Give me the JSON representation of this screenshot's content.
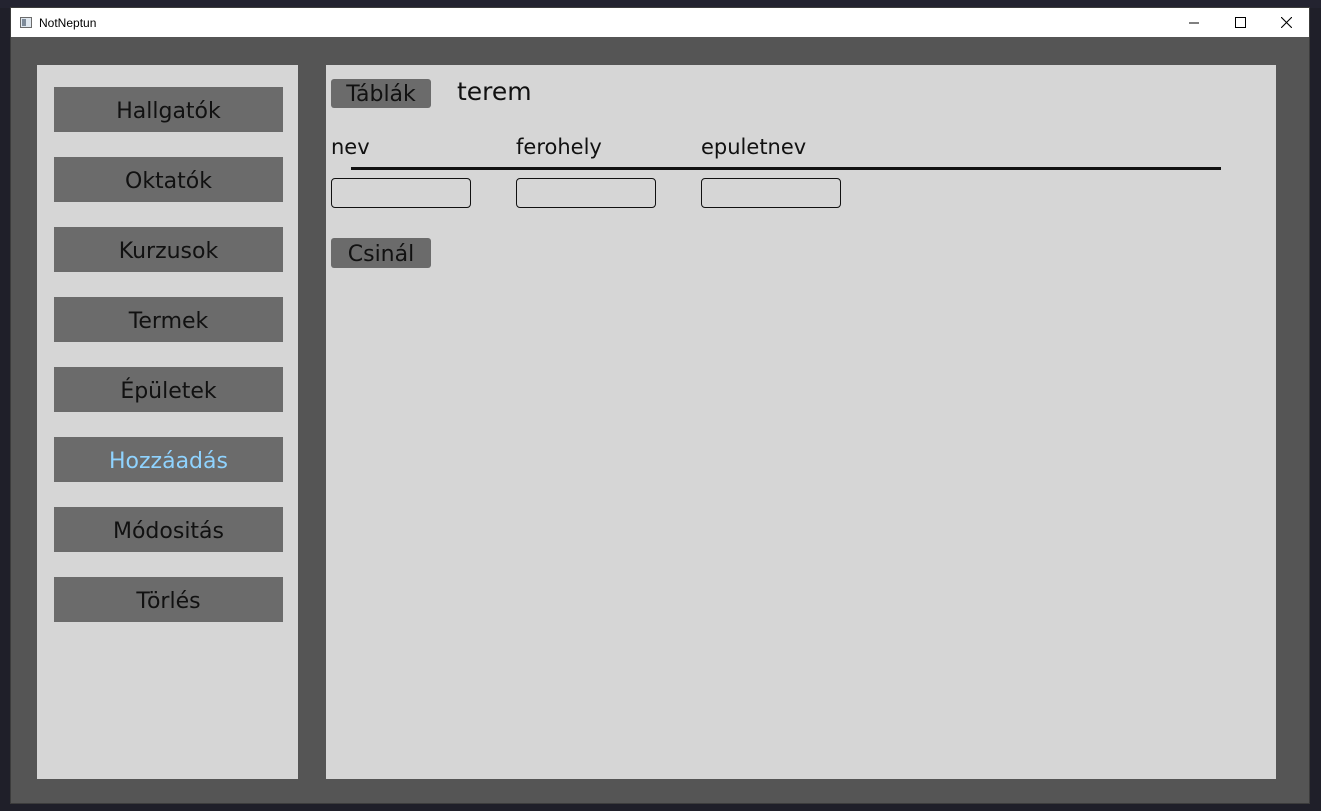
{
  "window": {
    "title": "NotNeptun"
  },
  "sidebar": {
    "items": [
      {
        "label": "Hallgatók",
        "active": false
      },
      {
        "label": "Oktatók",
        "active": false
      },
      {
        "label": "Kurzusok",
        "active": false
      },
      {
        "label": "Termek",
        "active": false
      },
      {
        "label": "Épületek",
        "active": false
      },
      {
        "label": "Hozzáadás",
        "active": true
      },
      {
        "label": "Módositás",
        "active": false
      },
      {
        "label": "Törlés",
        "active": false
      }
    ]
  },
  "main": {
    "tables_button_label": "Táblák",
    "table_name": "terem",
    "columns": [
      {
        "label": "nev",
        "value": ""
      },
      {
        "label": "ferohely",
        "value": ""
      },
      {
        "label": "epuletnev",
        "value": ""
      }
    ],
    "submit_label": "Csinál"
  },
  "colors": {
    "window_bg": "#555555",
    "panel_bg": "#d6d6d6",
    "button_bg": "#6b6b6b",
    "active_text": "#8fd3ff"
  },
  "icons": {
    "app": "app-window-icon",
    "minimize": "minimize-icon",
    "maximize": "maximize-icon",
    "close": "close-icon"
  }
}
